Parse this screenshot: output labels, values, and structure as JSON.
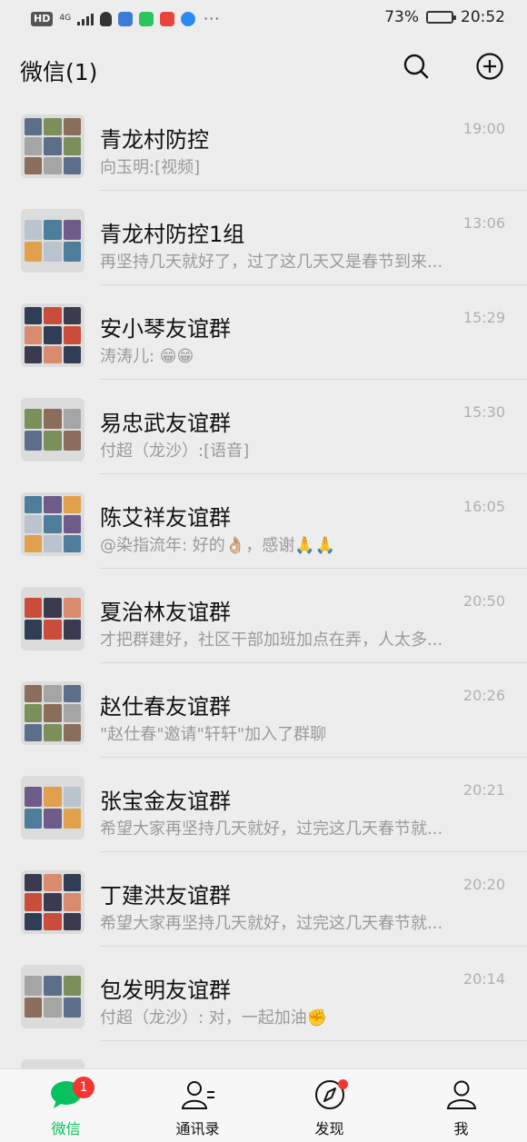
{
  "status_bar": {
    "hd": "HD",
    "network": "4G",
    "icons": [
      "qq-icon",
      "baidu-icon",
      "iqiyi-icon",
      "video-icon",
      "browser-icon"
    ],
    "more": "···",
    "battery": "73%",
    "battery_level": 0.73,
    "time": "20:52"
  },
  "header": {
    "title": "微信(1)",
    "search_icon": "search-icon",
    "add_icon": "plus-circle-icon"
  },
  "chats": [
    {
      "name": "青龙村防控",
      "msg": "向玉明:[视频]",
      "time": "19:00"
    },
    {
      "name": "青龙村防控1组",
      "msg": "再坚持几天就好了，过了这几天又是春节到来...",
      "time": "13:06"
    },
    {
      "name": "安小琴友谊群",
      "msg": "涛涛儿: 😁😁",
      "time": "15:29"
    },
    {
      "name": "易忠武友谊群",
      "msg": "付超（龙沙）:[语音]",
      "time": "15:30"
    },
    {
      "name": "陈艾祥友谊群",
      "msg": "@染指流年: 好的👌🏼，感谢🙏🙏",
      "time": "16:05"
    },
    {
      "name": "夏治林友谊群",
      "msg": "才把群建好，社区干部加班加点在弄，人太多...",
      "time": "20:50"
    },
    {
      "name": "赵仕春友谊群",
      "msg": "\"赵仕春\"邀请\"轩轩\"加入了群聊",
      "time": "20:26"
    },
    {
      "name": "张宝金友谊群",
      "msg": "希望大家再坚持几天就好，过完这几天春节就...",
      "time": "20:21"
    },
    {
      "name": "丁建洪友谊群",
      "msg": "希望大家再坚持几天就好，过完这几天春节就...",
      "time": "20:20"
    },
    {
      "name": "包发明友谊群",
      "msg": "付超（龙沙）: 对，一起加油✊",
      "time": "20:14"
    }
  ],
  "tabs": [
    {
      "label": "微信",
      "icon": "chat-bubble-icon",
      "badge": "1"
    },
    {
      "label": "通讯录",
      "icon": "contacts-icon"
    },
    {
      "label": "发现",
      "icon": "compass-icon"
    },
    {
      "label": "我",
      "icon": "person-icon"
    }
  ],
  "colors": {
    "accent": "#07c160",
    "badge": "#f43530",
    "background": "#ededed"
  }
}
